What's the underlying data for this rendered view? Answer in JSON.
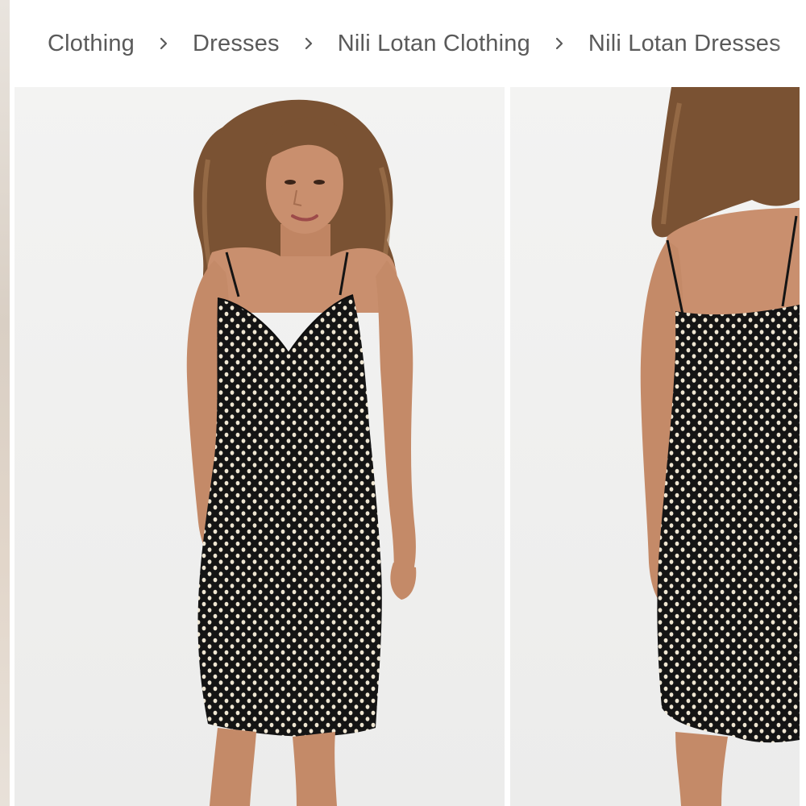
{
  "breadcrumb": {
    "items": [
      {
        "label": "Clothing"
      },
      {
        "label": "Dresses"
      },
      {
        "label": "Nili Lotan Clothing"
      },
      {
        "label": "Nili Lotan Dresses"
      }
    ],
    "separator_icon": "chevron-right-icon"
  },
  "colors": {
    "text": "#5a5a5a",
    "photo_background": "#f1f1f0",
    "dress": "#141414",
    "dots": "#efe6d2",
    "skin": "#c98f6e",
    "hair": "#7a5233"
  },
  "gallery": {
    "images": [
      {
        "subject": "front view of black polka dot slip dress"
      },
      {
        "subject": "back view of black polka dot slip dress"
      }
    ]
  }
}
